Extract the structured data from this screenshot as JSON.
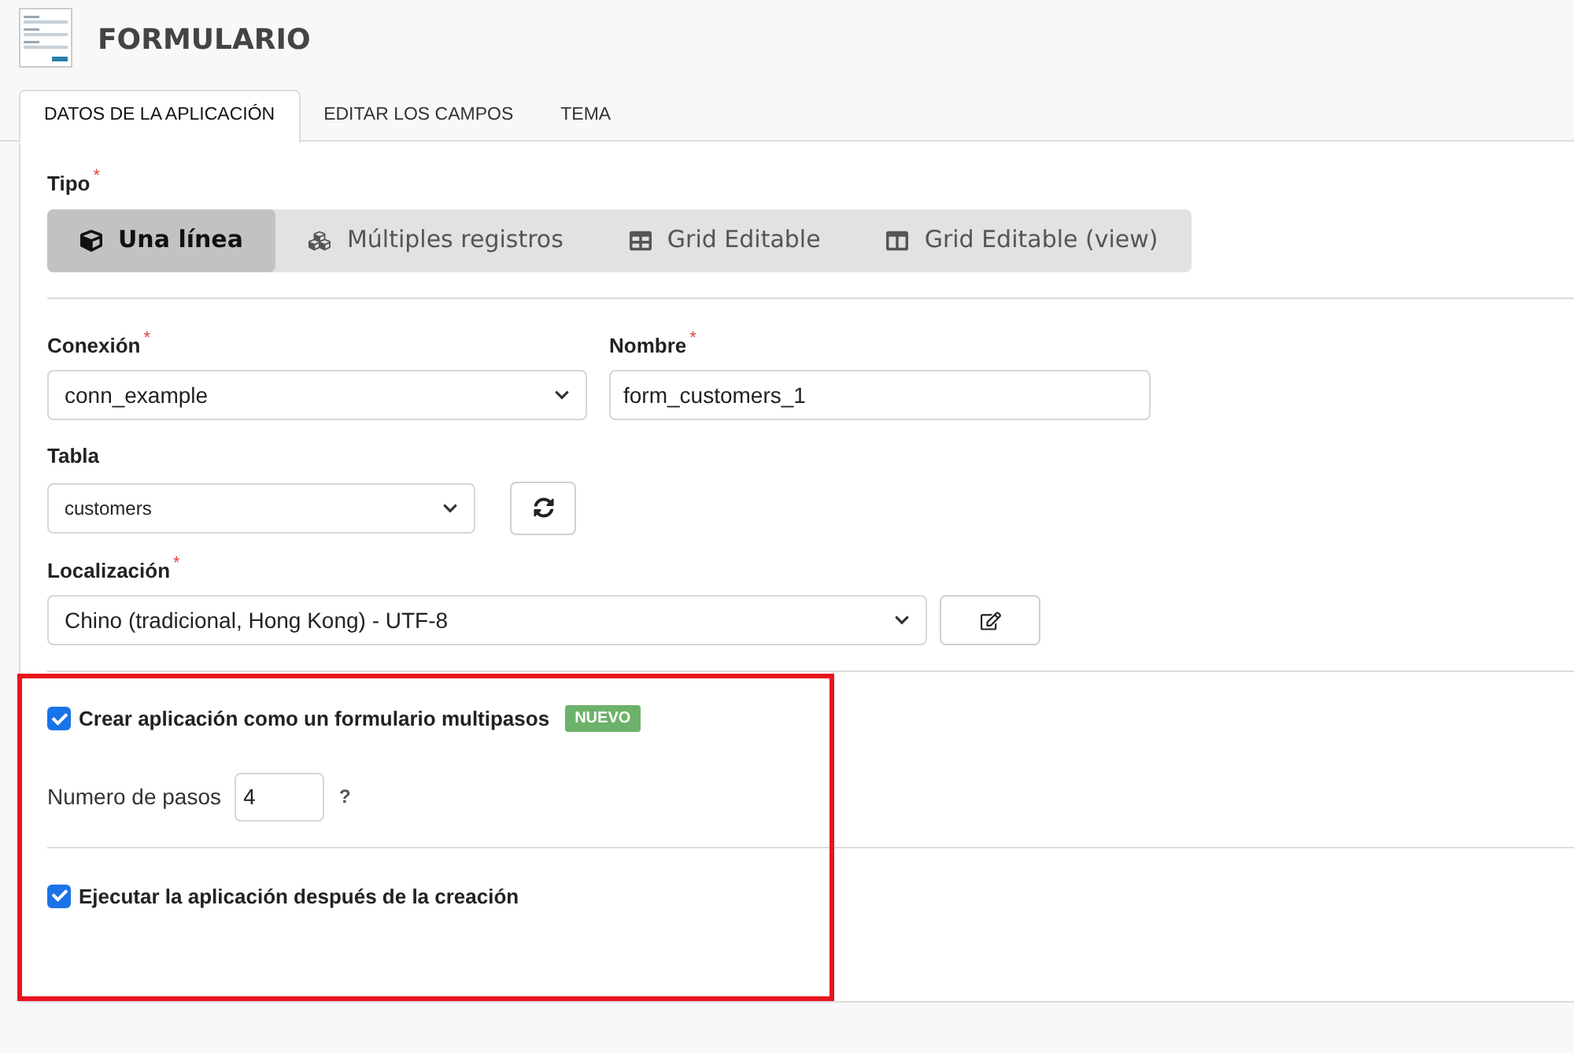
{
  "header": {
    "title": "FORMULARIO"
  },
  "tabs": [
    {
      "label": "DATOS DE LA APLICACIÓN",
      "selected": true
    },
    {
      "label": "EDITAR LOS CAMPOS",
      "selected": false
    },
    {
      "label": "TEMA",
      "selected": false
    }
  ],
  "tipo": {
    "label": "Tipo",
    "required_mark": "*",
    "options": [
      {
        "label": "Una línea",
        "kind": "cube",
        "selected": true
      },
      {
        "label": "Múltiples registros",
        "kind": "cubes",
        "selected": false
      },
      {
        "label": "Grid Editable",
        "kind": "table",
        "selected": false
      },
      {
        "label": "Grid Editable (view)",
        "kind": "columns",
        "selected": false
      }
    ]
  },
  "conexion": {
    "label": "Conexión",
    "required_mark": "*",
    "value": "conn_example"
  },
  "nombre": {
    "label": "Nombre",
    "required_mark": "*",
    "value": "form_customers_1"
  },
  "tabla": {
    "label": "Tabla",
    "value": "customers"
  },
  "localizacion": {
    "label": "Localización",
    "required_mark": "*",
    "value": "Chino (tradicional, Hong Kong) - UTF-8"
  },
  "multistep": {
    "label": "Crear aplicación como un formulario multipasos",
    "checked": true,
    "badge": "NUEVO"
  },
  "steps": {
    "label": "Numero de pasos",
    "value": "4",
    "help": "?"
  },
  "run_after": {
    "label": "Ejecutar la aplicación después de la creación",
    "checked": true
  }
}
